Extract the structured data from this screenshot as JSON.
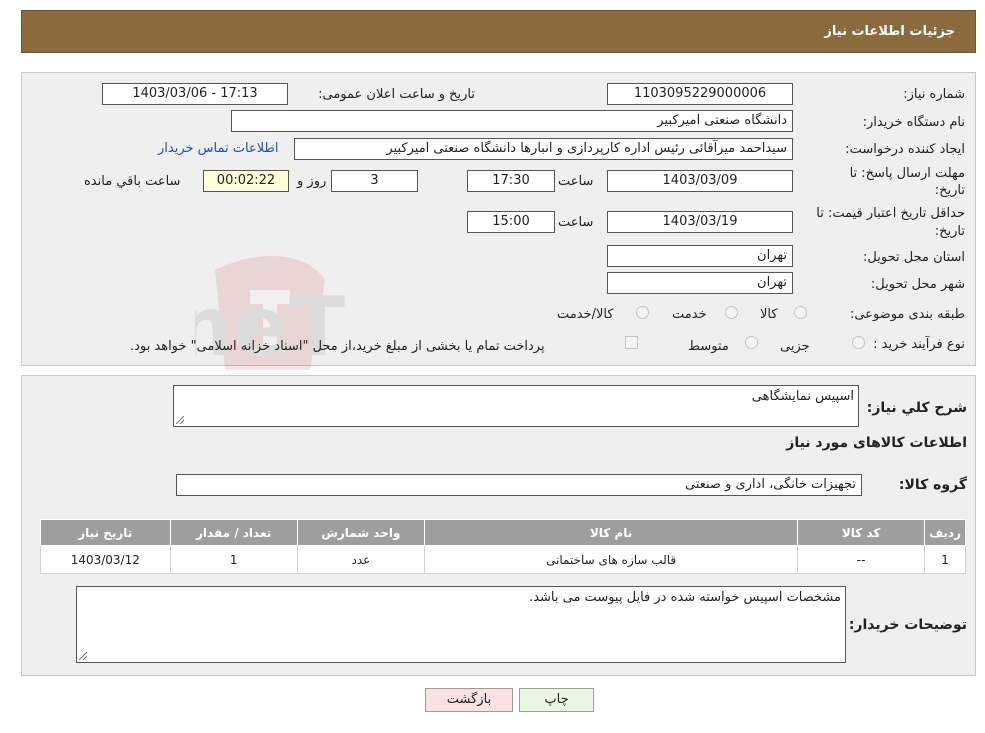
{
  "header": {
    "title": "جزئیات اطلاعات نیاز"
  },
  "info": {
    "need_number_label": "شماره نیاز:",
    "need_number": "1103095229000006",
    "announce_label": "تاریخ و ساعت اعلان عمومی:",
    "announce_value": "1403/03/06 - 17:13",
    "buyer_org_label": "نام دستگاه خریدار:",
    "buyer_org": "دانشگاه صنعتی امیرکبیر",
    "creator_label": "ایجاد کننده درخواست:",
    "creator": "سیداحمد میرآقائی رئیس اداره کارپردازی و انبارها دانشگاه صنعتی امیرکبیر",
    "contact_link": "اطلاعات تماس خریدار",
    "reply_deadline_label_1": "مهلت ارسال پاسخ: تا",
    "reply_deadline_label_2": "تاریخ:",
    "reply_date": "1403/03/09",
    "time_label": "ساعت",
    "reply_time": "17:30",
    "days_value": "3",
    "days_label": "روز و",
    "remaining_time": "00:02:22",
    "remaining_label": "ساعت باقي مانده",
    "validity_label_1": "حداقل تاریخ اعتبار قیمت: تا",
    "validity_label_2": "تاریخ:",
    "validity_date": "1403/03/19",
    "validity_time": "15:00",
    "province_label": "استان محل تحویل:",
    "province": "تهران",
    "city_label": "شهر محل تحویل:",
    "city": "تهران",
    "category_label": "طبقه بندی موضوعی:",
    "category_options": [
      "کالا",
      "خدمت",
      "کالا/خدمت"
    ],
    "process_label": "نوع فرآیند خرید :",
    "process_options": [
      "جزیی",
      "متوسط"
    ],
    "payment_note": "پرداخت تمام یا بخشی از مبلغ خرید،از محل \"اسناد خزانه اسلامی\" خواهد بود."
  },
  "details": {
    "summary_label": "شرح کلي نياز:",
    "summary": "اسپیس نمایشگاهی",
    "goods_info_title": "اطلاعات کالاهای مورد نیاز",
    "goods_group_label": "گروه کالا:",
    "goods_group": "تجهیزات خانگی، اداری و صنعتی",
    "table": {
      "headers": [
        "ردیف",
        "کد کالا",
        "نام کالا",
        "واحد شمارش",
        "تعداد / مقدار",
        "تاریخ نیاز"
      ],
      "rows": [
        [
          "1",
          "--",
          "قالب سازه های ساختمانی",
          "عدد",
          "1",
          "1403/03/12"
        ]
      ]
    },
    "buyer_notes_label": "توضیحات خریدار:",
    "buyer_notes": "مشخصات اسپیس خواسته شده در فایل پیوست می باشد."
  },
  "buttons": {
    "print": "چاپ",
    "back": "بازگشت"
  },
  "watermark": {
    "text": "AriaTender.neT"
  },
  "colors": {
    "header_bg": "#8b6a3e",
    "panel_bg": "#efefef",
    "link": "#1d4ec3",
    "table_head": "#9e9e9e",
    "timer_bg": "#ffffd9"
  }
}
